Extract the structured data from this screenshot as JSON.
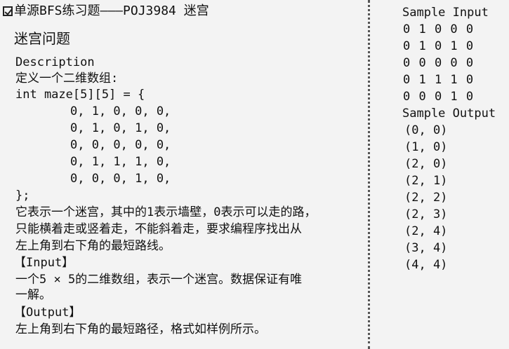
{
  "title": {
    "text": "单源BFS练习题———POJ3984 迷宫",
    "icon": "checkbox-icon"
  },
  "heading": "迷宫问题",
  "description": {
    "label": "Description",
    "intro": "定义一个二维数组:",
    "decl": "int maze[5][5] = {",
    "rows": [
      "0, 1, 0, 0, 0,",
      "0, 1, 0, 1, 0,",
      "0, 0, 0, 0, 0,",
      "0, 1, 1, 1, 0,",
      "0, 0, 0, 1, 0,"
    ],
    "close": "};",
    "text_lines": [
      "它表示一个迷宫，其中的1表示墙壁，0表示可以走的路，",
      "只能横着走或竖着走，不能斜着走，要求编程序找出从",
      "左上角到右下角的最短路线。"
    ]
  },
  "input": {
    "label": "【Input】",
    "lines": [
      "一个5 × 5的二维数组，表示一个迷宫。数据保证有唯",
      "一解。"
    ]
  },
  "output": {
    "label": "【Output】",
    "lines": [
      "左上角到右下角的最短路径，格式如样例所示。"
    ]
  },
  "sample_input": {
    "label": "Sample Input",
    "rows": [
      "0 1 0 0 0",
      "0 1 0 1 0",
      "0 0 0 0 0",
      "0 1 1 1 0",
      "0 0 0 1 0"
    ]
  },
  "sample_output": {
    "label": "Sample Output",
    "rows": [
      "(0, 0)",
      "(1, 0)",
      "(2, 0)",
      "(2, 1)",
      "(2, 2)",
      "(2, 3)",
      "(2, 4)",
      "(3, 4)",
      "(4, 4)"
    ]
  }
}
